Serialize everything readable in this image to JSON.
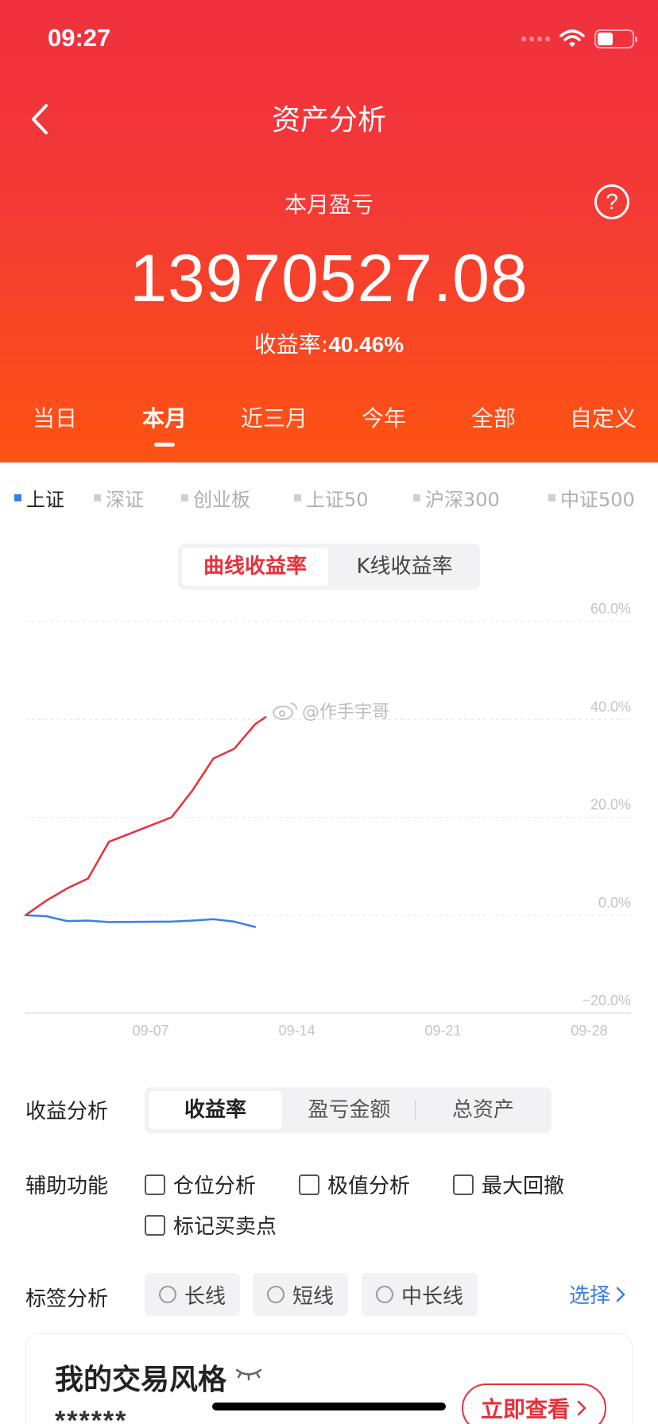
{
  "status": {
    "time": "09:27"
  },
  "header": {
    "title": "资产分析",
    "month_label": "本月盈亏",
    "amount": "13970527.08",
    "rate_label": "收益率:",
    "rate_value": "40.46%",
    "help_glyph": "?"
  },
  "period_tabs": [
    {
      "label": "当日"
    },
    {
      "label": "本月",
      "active": true
    },
    {
      "label": "近三月"
    },
    {
      "label": "今年"
    },
    {
      "label": "全部"
    },
    {
      "label": "自定义"
    }
  ],
  "indices": [
    {
      "label": "上证",
      "active": true
    },
    {
      "label": "深证"
    },
    {
      "label": "创业板"
    },
    {
      "label": "上证50"
    },
    {
      "label": "沪深300"
    },
    {
      "label": "中证500"
    }
  ],
  "curve_toggle": {
    "active": "曲线收益率",
    "inactive": "K线收益率"
  },
  "watermark": "@作手宇哥",
  "chart_data": {
    "type": "line",
    "y_tick_labels": [
      "60.0%",
      "40.0%",
      "20.0%",
      "0.0%",
      "−20.0%"
    ],
    "y_ticks": [
      60,
      40,
      20,
      0,
      -20
    ],
    "ylim": [
      -20,
      60
    ],
    "x_tick_labels": [
      "09-07",
      "09-14",
      "09-21",
      "09-28"
    ],
    "x_ticks": [
      7,
      14,
      21,
      28
    ],
    "xlim": [
      1,
      30
    ],
    "grid": true,
    "series": [
      {
        "color": "#e8303b",
        "x": [
          1,
          2,
          3,
          4,
          5,
          8,
          9,
          10,
          11,
          12,
          12.5
        ],
        "y": [
          0,
          3,
          5.5,
          7.5,
          15,
          20,
          25.5,
          32,
          34,
          39,
          40.46
        ]
      },
      {
        "color": "#3b7ee8",
        "x": [
          1,
          2,
          3,
          4,
          5,
          8,
          9,
          10,
          11,
          12
        ],
        "y": [
          0,
          -0.2,
          -1.2,
          -1.1,
          -1.4,
          -1.3,
          -1.1,
          -0.8,
          -1.3,
          -2.4
        ]
      }
    ]
  },
  "analysis": {
    "label": "收益分析",
    "options": [
      "收益率",
      "盈亏金额",
      "总资产"
    ]
  },
  "aux": {
    "label": "辅助功能",
    "options": [
      "仓位分析",
      "极值分析",
      "最大回撤",
      "标记买卖点"
    ]
  },
  "tags": {
    "label": "标签分析",
    "options": [
      "长线",
      "短线",
      "中长线"
    ],
    "select": "选择"
  },
  "style_card": {
    "title": "我的交易风格",
    "masked": "******",
    "button": "立即查看"
  }
}
